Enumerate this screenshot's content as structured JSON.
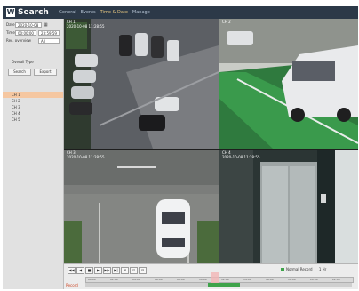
{
  "app": {
    "logo": "W",
    "title": "Search"
  },
  "menu": [
    "General",
    "Events",
    "Time & Date",
    "Manage"
  ],
  "menu_active_index": 2,
  "sidebar": {
    "date_label": "Date",
    "date_value": "2020-10-08",
    "time_label": "Time",
    "time_start": "00:00:00",
    "time_end": "23:59:59",
    "rec_label": "Rec. overview",
    "rec_value": "All",
    "section_label": "Overall Type",
    "btn_search": "Search",
    "btn_export": "Export",
    "tree": [
      "CH 1",
      "CH 2",
      "CH 3",
      "CH 4",
      "CH 5"
    ]
  },
  "cameras": [
    {
      "name": "CH 1",
      "time": "2020-10-08 11:28:55"
    },
    {
      "name": "CH 2",
      "time": ""
    },
    {
      "name": "CH 3",
      "time": "2020-10-08 11:28:55"
    },
    {
      "name": "CH 4",
      "time": "2020-10-08 11:28:55"
    }
  ],
  "timeline": {
    "controls": [
      "◀◀",
      "◀",
      "■",
      "▶",
      "▶▶",
      "▶|",
      "⊞",
      "⊡",
      "⊟"
    ],
    "legend": "Normal Record",
    "range": "1 Hr",
    "ticks": [
      "00:00",
      "02:00",
      "04:00",
      "06:00",
      "08:00",
      "10:00",
      "12:00",
      "14:00",
      "16:00",
      "18:00",
      "20:00",
      "22:00"
    ],
    "track_label": "Record",
    "recorded_start_fraction": 0.46,
    "recorded_end_fraction": 0.58,
    "cursor_fraction": 0.47
  }
}
